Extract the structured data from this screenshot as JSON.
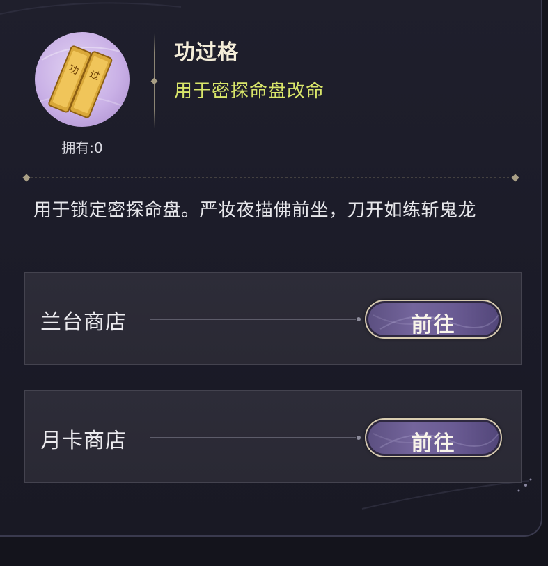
{
  "item": {
    "name": "功过格",
    "subtitle": "用于密探命盘改命",
    "owned": "拥有:0",
    "icon": "golden-tablets-icon",
    "icon_glyphs": [
      "功",
      "过"
    ]
  },
  "description": "用于锁定密探命盘。严妆夜描佛前坐，刀开如练斩鬼龙",
  "sources": [
    {
      "label": "兰台商店",
      "button_label": "前往"
    },
    {
      "label": "月卡商店",
      "button_label": "前往"
    }
  ],
  "colors": {
    "background": "#1d1d29",
    "title": "#f3ecd8",
    "subtitle": "#d9e66a",
    "button": "#6a5b93",
    "button_border": "#d8ccb0"
  }
}
